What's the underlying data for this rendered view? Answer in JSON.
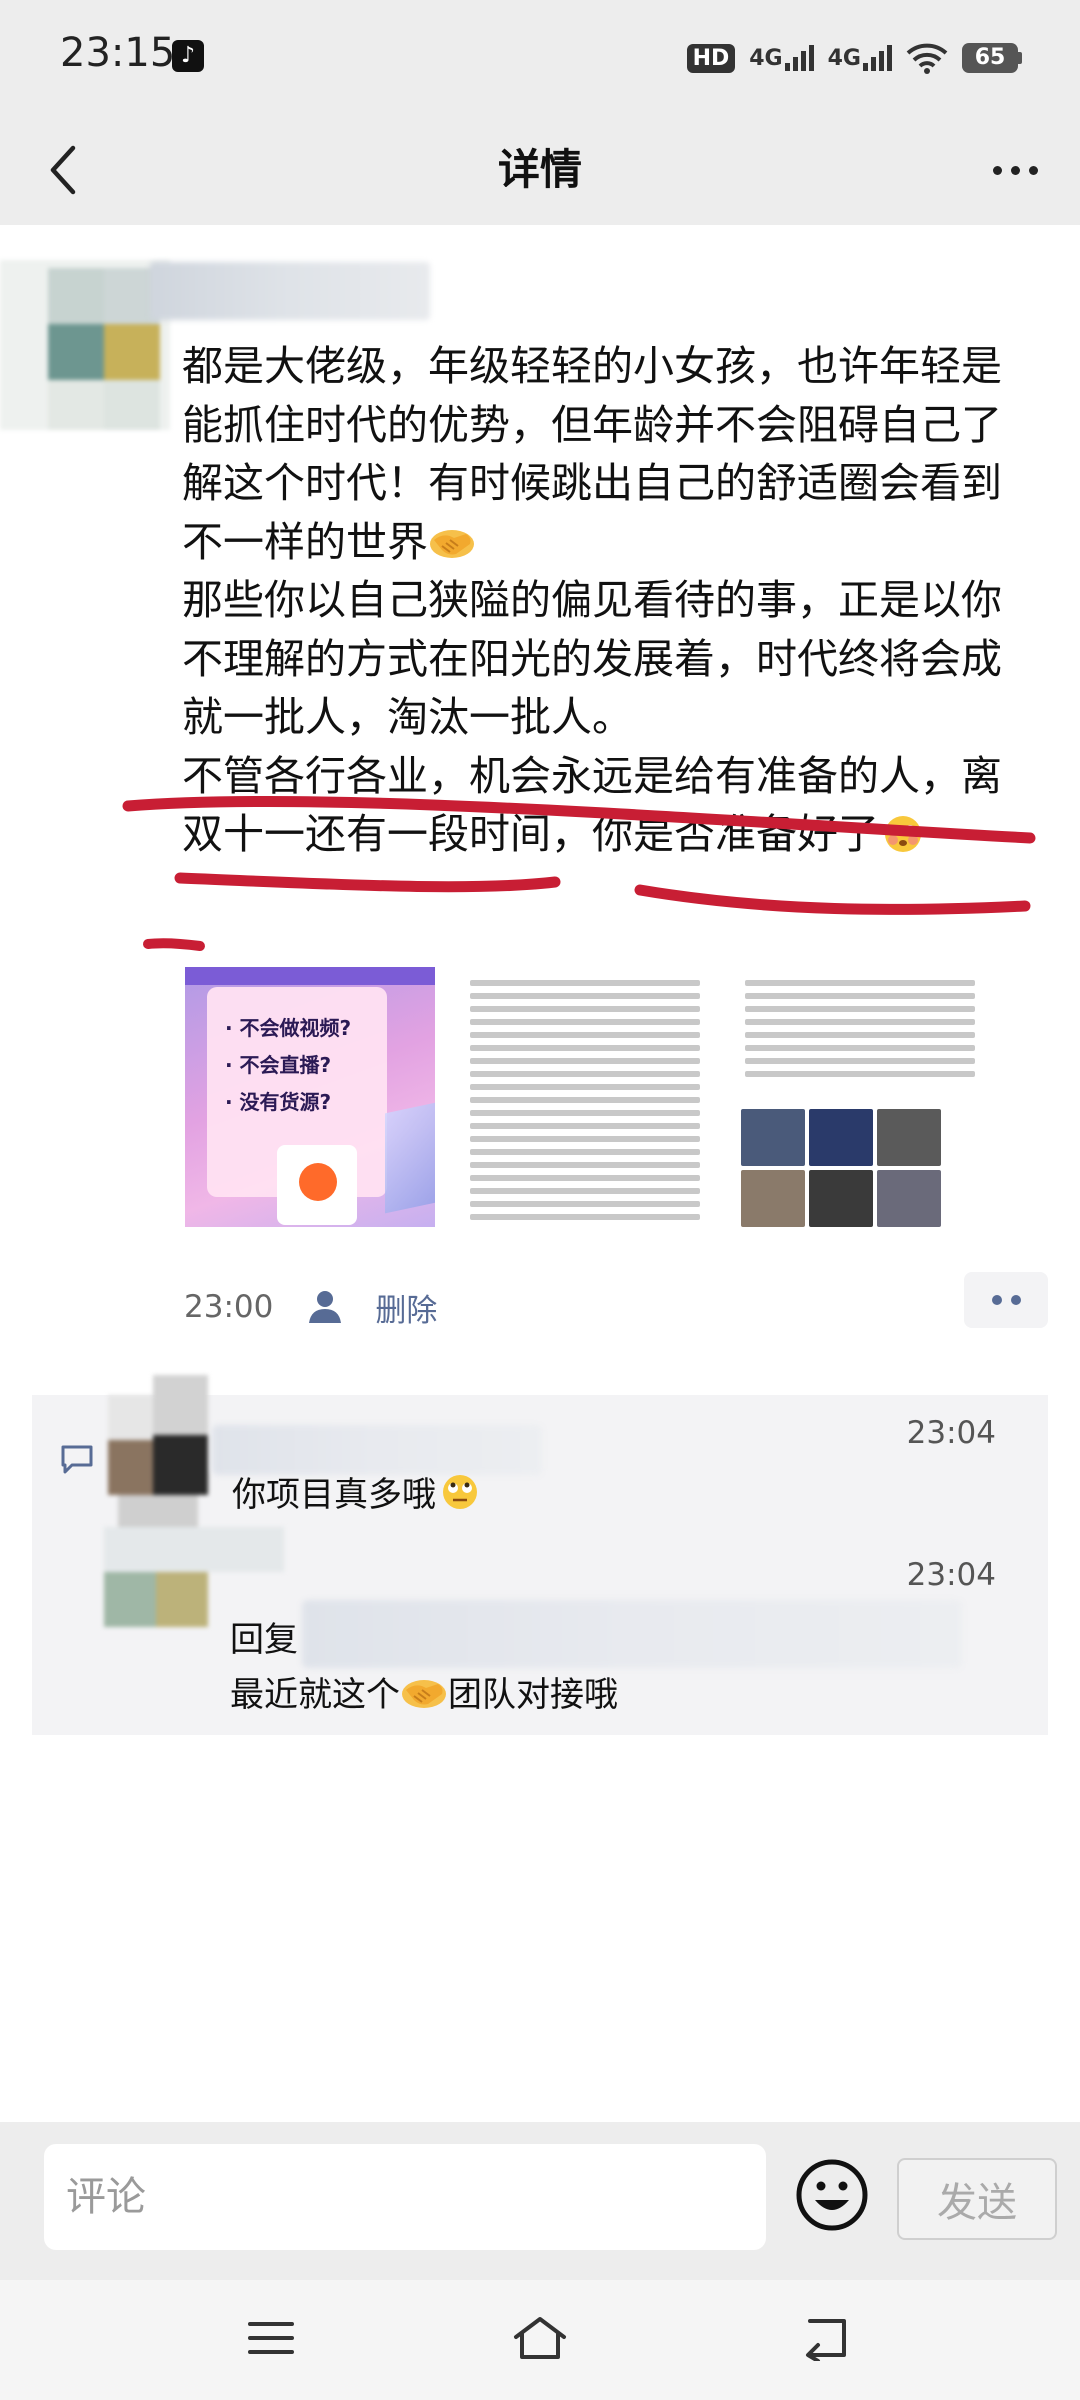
{
  "status_bar": {
    "time": "23:15",
    "hd_label": "HD",
    "net1_label": "4G",
    "net2_label": "4G",
    "battery": "65"
  },
  "header": {
    "title": "详情",
    "back_icon": "chevron-left-icon",
    "more_icon": "more-dots-icon"
  },
  "post": {
    "paragraphs": [
      "都是大佬级，年级轻轻的小女孩，也许年轻是能抓住时代的优势，但年龄并不会阻碍自己了解这个时代！有时候跳出自己的舒适圈会看到不一样的世界",
      "那些你以自己狭隘的偏见看待的事，正是以你不理解的方式在阳光的发展着，时代终将会成就一批人，淘汰一批人。",
      "不管各行各业，机会永远是给有准备的人，离双十一还有一段时间，你是否准备好了"
    ],
    "images": {
      "thumb1_lines": [
        "· 不会做视频?",
        "· 不会直播?",
        "· 没有货源?"
      ]
    },
    "time": "23:00",
    "delete_label": "删除",
    "highlight_color": "#c81e34"
  },
  "comments": [
    {
      "time": "23:04",
      "text": "你项目真多哦"
    },
    {
      "time": "23:04",
      "reply_prefix": "回复",
      "text_before": "最近就这个",
      "text_after": "团队对接哦"
    }
  ],
  "input": {
    "placeholder": "评论",
    "send_label": "发送"
  }
}
